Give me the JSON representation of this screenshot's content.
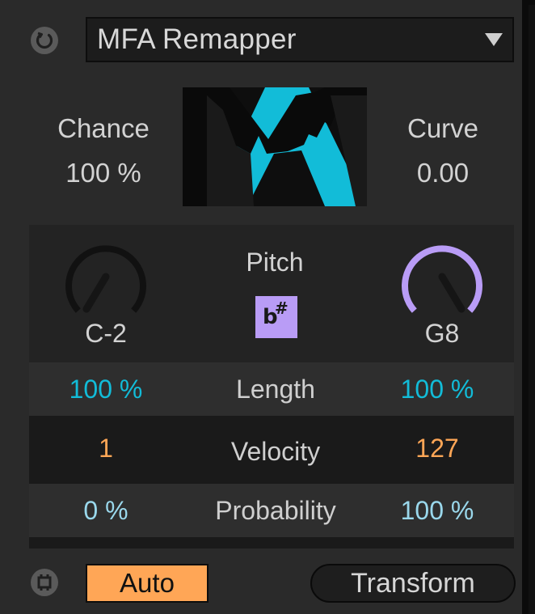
{
  "colors": {
    "cyan": "#12bcd8",
    "orange": "#ffa656",
    "light_blue": "#9ad8ec",
    "purple": "#b99cf6",
    "text": "#d2d2d2"
  },
  "header": {
    "title": "MFA Remapper",
    "power_icon": "power-icon",
    "dropdown_icon": "chevron-down-icon"
  },
  "params": {
    "chance": {
      "label": "Chance",
      "value": "100 %"
    },
    "curve": {
      "label": "Curve",
      "value": "0.00"
    }
  },
  "pitch": {
    "title": "Pitch",
    "low": {
      "value": "C-2",
      "level": 0.0
    },
    "high": {
      "value": "G8",
      "level": 1.0
    },
    "accidental_flat": "b",
    "accidental_sharp": "#"
  },
  "rows": [
    {
      "label": "Length",
      "min": "100 %",
      "max": "100 %",
      "color": "#12bcd8"
    },
    {
      "label": "Velocity",
      "min": "1",
      "max": "127",
      "color": "#ffa656"
    },
    {
      "label": "Probability",
      "min": "0 %",
      "max": "100 %",
      "color": "#9ad8ec"
    }
  ],
  "footer": {
    "auto_label": "Auto",
    "transform_label": "Transform",
    "footer_icon": "clip-icon"
  }
}
